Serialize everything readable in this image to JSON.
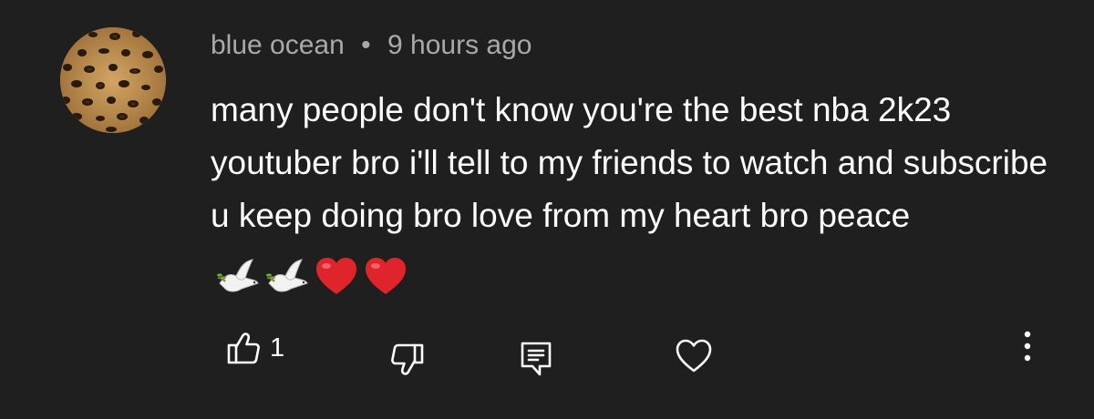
{
  "comment": {
    "author": "blue ocean",
    "separator": "•",
    "timestamp": "9 hours ago",
    "text": "many people don't know you're the best nba 2k23 youtuber bro i'll tell to my friends to watch and subscribe u keep doing bro love from my heart bro peace",
    "emojis": [
      "dove-emoji",
      "dove-emoji",
      "red-heart-emoji",
      "red-heart-emoji"
    ]
  },
  "actions": {
    "like_count": "1",
    "like_icon": "thumbs-up-icon",
    "dislike_icon": "thumbs-down-icon",
    "reply_icon": "reply-comment-icon",
    "heart_icon": "heart-outline-icon",
    "more_icon": "more-vertical-icon"
  },
  "colors": {
    "background": "#1f1f1f",
    "meta_text": "#a9a9a9",
    "body_text": "#ffffff",
    "heart_emoji": "#e0242c"
  }
}
